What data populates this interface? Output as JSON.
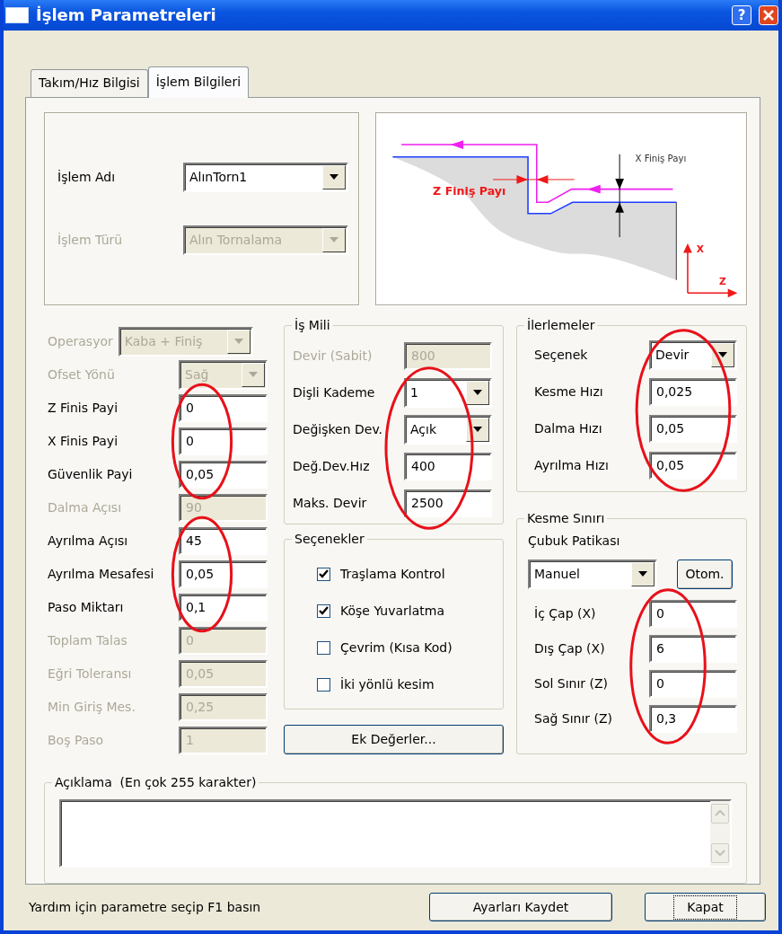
{
  "window": {
    "title": "İşlem Parametreleri",
    "help_button": "?"
  },
  "tabs": [
    {
      "label": "Takım/Hız Bilgisi",
      "selected": false
    },
    {
      "label": "İşlem Bilgileri",
      "selected": true
    }
  ],
  "operation": {
    "fields": [
      {
        "label": "İşlem Adı",
        "value": "AlınTorn1",
        "kind": "dropdown",
        "disabled": false
      },
      {
        "label": "İşlem Türü",
        "value": "Alın Tornalama",
        "kind": "dropdown",
        "disabled": true
      }
    ]
  },
  "diagram": {
    "x_finish_label": "X Finiş Payı",
    "z_finish_label": "Z Finiş Payı",
    "x_axis_label": "X",
    "z_axis_label": "Z"
  },
  "left_fields": [
    {
      "label": "Operasyor",
      "value": "Kaba + Finiş",
      "kind": "wide-dropdown",
      "disabled": true,
      "circled": false
    },
    {
      "label": "Ofset Yönü",
      "value": "Sağ",
      "kind": "dropdown",
      "disabled": true,
      "circled": false
    },
    {
      "label": "Z Finis Payi",
      "value": "0",
      "kind": "text",
      "disabled": false,
      "circled": true
    },
    {
      "label": "X Finis Payi",
      "value": "0",
      "kind": "text",
      "disabled": false,
      "circled": true
    },
    {
      "label": "Güvenlik Payi",
      "value": "0,05",
      "kind": "text",
      "disabled": false,
      "circled": true
    },
    {
      "label": "Dalma Açısı",
      "value": "90",
      "kind": "text",
      "disabled": true,
      "circled": false
    },
    {
      "label": "Ayrılma Açısı",
      "value": "45",
      "kind": "text",
      "disabled": false,
      "circled": true
    },
    {
      "label": "Ayrılma Mesafesi",
      "value": "0,05",
      "kind": "text",
      "disabled": false,
      "circled": true
    },
    {
      "label": "Paso Miktarı",
      "value": "0,1",
      "kind": "text",
      "disabled": false,
      "circled": true
    },
    {
      "label": "Toplam Talas",
      "value": "0",
      "kind": "text",
      "disabled": true,
      "circled": false
    },
    {
      "label": "Eğri Toleransı",
      "value": "0,05",
      "kind": "text",
      "disabled": true,
      "circled": false
    },
    {
      "label": "Min Giriş Mes.",
      "value": "0,25",
      "kind": "text",
      "disabled": true,
      "circled": false
    },
    {
      "label": "Boş Paso",
      "value": "1",
      "kind": "text",
      "disabled": true,
      "circled": false
    }
  ],
  "spindle": {
    "title": "İş Mili",
    "fields": [
      {
        "label": "Devir (Sabit)",
        "value": "800",
        "kind": "text",
        "disabled": true,
        "circled": false
      },
      {
        "label": "Dişli Kademe",
        "value": "1",
        "kind": "dropdown",
        "disabled": false,
        "circled": true
      },
      {
        "label": "Değişken Dev.",
        "value": "Açık",
        "kind": "dropdown",
        "disabled": false,
        "circled": true
      },
      {
        "label": "Değ.Dev.Hız",
        "value": "400",
        "kind": "text",
        "disabled": false,
        "circled": true
      },
      {
        "label": "Maks. Devir",
        "value": "2500",
        "kind": "text",
        "disabled": false,
        "circled": true
      }
    ]
  },
  "options": {
    "title": "Seçenekler",
    "items": [
      {
        "label": "Traşlama Kontrol",
        "checked": true
      },
      {
        "label": "Köşe Yuvarlatma",
        "checked": true
      },
      {
        "label": "Çevrim (Kısa Kod)",
        "checked": false
      },
      {
        "label": "İki yönlü kesim",
        "checked": false
      }
    ]
  },
  "extra_button": "Ek Değerler...",
  "feeds": {
    "title": "İlerlemeler",
    "fields": [
      {
        "label": "Seçenek",
        "value": "Devir",
        "kind": "dropdown",
        "disabled": false,
        "circled": true
      },
      {
        "label": "Kesme Hızı",
        "value": "0,025",
        "kind": "text",
        "disabled": false,
        "circled": true
      },
      {
        "label": "Dalma Hızı",
        "value": "0,05",
        "kind": "text",
        "disabled": false,
        "circled": true
      },
      {
        "label": "Ayrılma Hızı",
        "value": "0,05",
        "kind": "text",
        "disabled": false,
        "circled": true
      }
    ]
  },
  "cut_limit": {
    "title": "Kesme Sınırı",
    "path_label": "Çubuk Patikası",
    "path_value": "Manuel",
    "auto_button": {
      "label": "Otom."
    },
    "fields": [
      {
        "label": "İç Çap (X)",
        "value": "0",
        "kind": "text",
        "disabled": false,
        "circled": true
      },
      {
        "label": "Dış Çap (X)",
        "value": "6",
        "kind": "text",
        "disabled": false,
        "circled": true
      },
      {
        "label": "Sol Sınır (Z)",
        "value": "0",
        "kind": "text",
        "disabled": false,
        "circled": true
      },
      {
        "label": "Sağ Sınır (Z)",
        "value": "0,3",
        "kind": "text",
        "disabled": false,
        "circled": true
      }
    ]
  },
  "description": {
    "title": "Açıklama  (En çok 255 karakter)"
  },
  "status_text": "Yardım için parametre seçip F1 basın",
  "buttons": [
    {
      "label": "Ayarları Kaydet",
      "focused": false
    },
    {
      "label": "Kapat",
      "focused": true
    }
  ]
}
